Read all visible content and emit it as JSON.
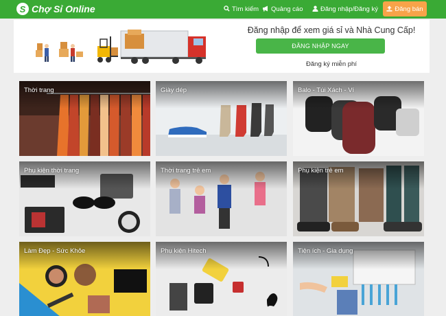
{
  "header": {
    "logo_mark": "S",
    "logo_text": "Chợ Sỉ Online",
    "search_label": "Tìm kiếm",
    "ads_label": "Quảng cáo",
    "login_label": "Đăng nhập/Đăng ký",
    "post_label": "Đăng bán"
  },
  "banner": {
    "title": "Đăng nhập để xem giá sỉ và Nhà Cung Cấp!",
    "login_button": "ĐĂNG NHẬP NGAY",
    "register_link": "Đăng ký miễn phí"
  },
  "categories": [
    {
      "label": "Thời trang"
    },
    {
      "label": "Giày dép"
    },
    {
      "label": "Balo - Túi Xách - Ví"
    },
    {
      "label": "Phụ kiện thời trang"
    },
    {
      "label": "Thời trang trẻ em"
    },
    {
      "label": "Phụ kiện trẻ em"
    },
    {
      "label": "Làm Đẹp - Sức Khỏe"
    },
    {
      "label": "Phụ kiện Hitech"
    },
    {
      "label": "Tiện ích - Gia dụng"
    }
  ],
  "colors": {
    "brand_green": "#3aaa35",
    "button_green": "#49b548",
    "post_orange": "#f8a349"
  },
  "icons": {
    "search": "search-icon",
    "ads": "megaphone-icon",
    "user": "user-icon",
    "upload": "upload-icon"
  }
}
